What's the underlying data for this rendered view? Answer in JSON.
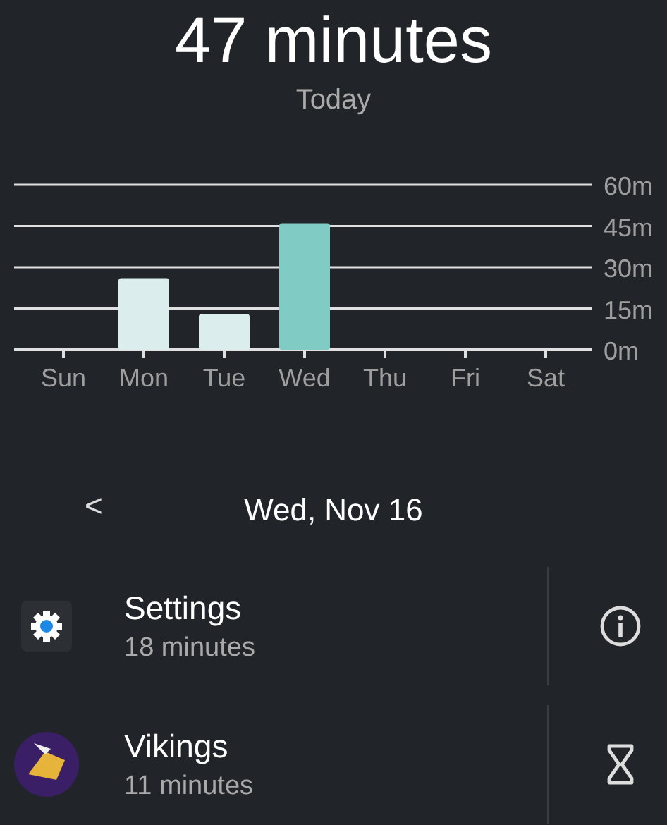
{
  "summary": {
    "total": "47 minutes",
    "period": "Today"
  },
  "chart": {
    "chart_data": {
      "type": "bar",
      "stacked": true,
      "categories": [
        "Sun",
        "Mon",
        "Tue",
        "Wed",
        "Thu",
        "Fri",
        "Sat"
      ],
      "grid": true,
      "series": [
        {
          "color": "#dbeeed",
          "values": [
            0,
            26,
            13,
            null,
            0,
            0,
            0
          ]
        },
        {
          "color": "#80cbc4",
          "values": [
            null,
            null,
            null,
            46,
            null,
            null,
            null
          ]
        }
      ],
      "ylim": [
        0,
        60
      ],
      "yticks": [
        {
          "value": 0,
          "label": "0m"
        },
        {
          "value": 15,
          "label": "15m"
        },
        {
          "value": 30,
          "label": "30m"
        },
        {
          "value": 45,
          "label": "45m"
        },
        {
          "value": 60,
          "label": "60m"
        }
      ]
    }
  },
  "date_nav": {
    "previous": "<",
    "date": "Wed, Nov 16"
  },
  "apps": [
    {
      "kind": "settings",
      "name": "Settings",
      "usage": "18 minutes",
      "action": {
        "kind": "info"
      }
    },
    {
      "kind": "game",
      "name": "Vikings",
      "usage": "11 minutes",
      "action": {
        "kind": "timer"
      }
    }
  ]
}
